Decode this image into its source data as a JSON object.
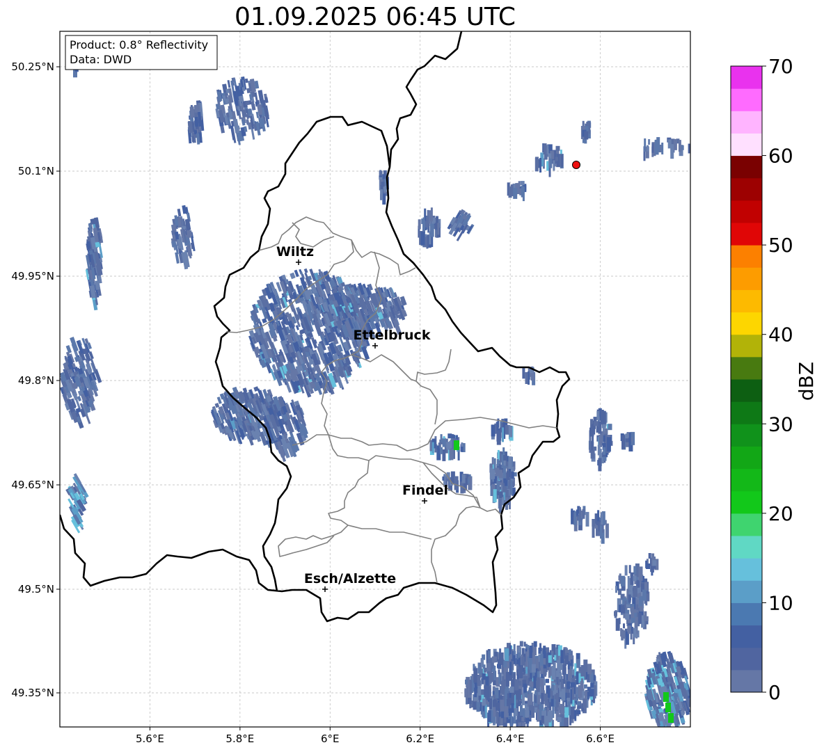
{
  "title": "01.09.2025 06:45 UTC",
  "info_box": {
    "product": "Product: 0.8° Reflectivity",
    "data": "Data: DWD"
  },
  "x_ticks": [
    "5.6°E",
    "5.8°E",
    "6°E",
    "6.2°E",
    "6.4°E",
    "6.6°E"
  ],
  "y_ticks": [
    "50.25°N",
    "50.1°N",
    "49.95°N",
    "49.8°N",
    "49.65°N",
    "49.5°N",
    "49.35°N"
  ],
  "cities": [
    {
      "name": "Wiltz",
      "lon": 5.93,
      "lat": 49.97
    },
    {
      "name": "Ettelbruck",
      "lon": 6.1,
      "lat": 49.85
    },
    {
      "name": "Findel",
      "lon": 6.21,
      "lat": 49.63
    },
    {
      "name": "Esch/Alzette",
      "lon": 5.99,
      "lat": 49.5
    }
  ],
  "radar_site": {
    "lon": 6.55,
    "lat": 50.11,
    "color": "#ee1111"
  },
  "colorbar": {
    "label": "dBZ",
    "ticks": [
      "0",
      "10",
      "20",
      "30",
      "40",
      "50",
      "60",
      "70"
    ],
    "colors": [
      "#6577a6",
      "#5065a0",
      "#4360a2",
      "#4b79b1",
      "#5b9ec8",
      "#66c0dc",
      "#60d8c4",
      "#3fd46f",
      "#12c81a",
      "#13b818",
      "#12a716",
      "#10921b",
      "#0e7916",
      "#0d5f12",
      "#487a10",
      "#b2b308",
      "#fdd600",
      "#fdba00",
      "#fd9c00",
      "#fc8000",
      "#e00606",
      "#c10101",
      "#9d0101",
      "#7a0101",
      "#ffe0ff",
      "#ffb4ff",
      "#ff6bff",
      "#e932ee"
    ]
  }
}
